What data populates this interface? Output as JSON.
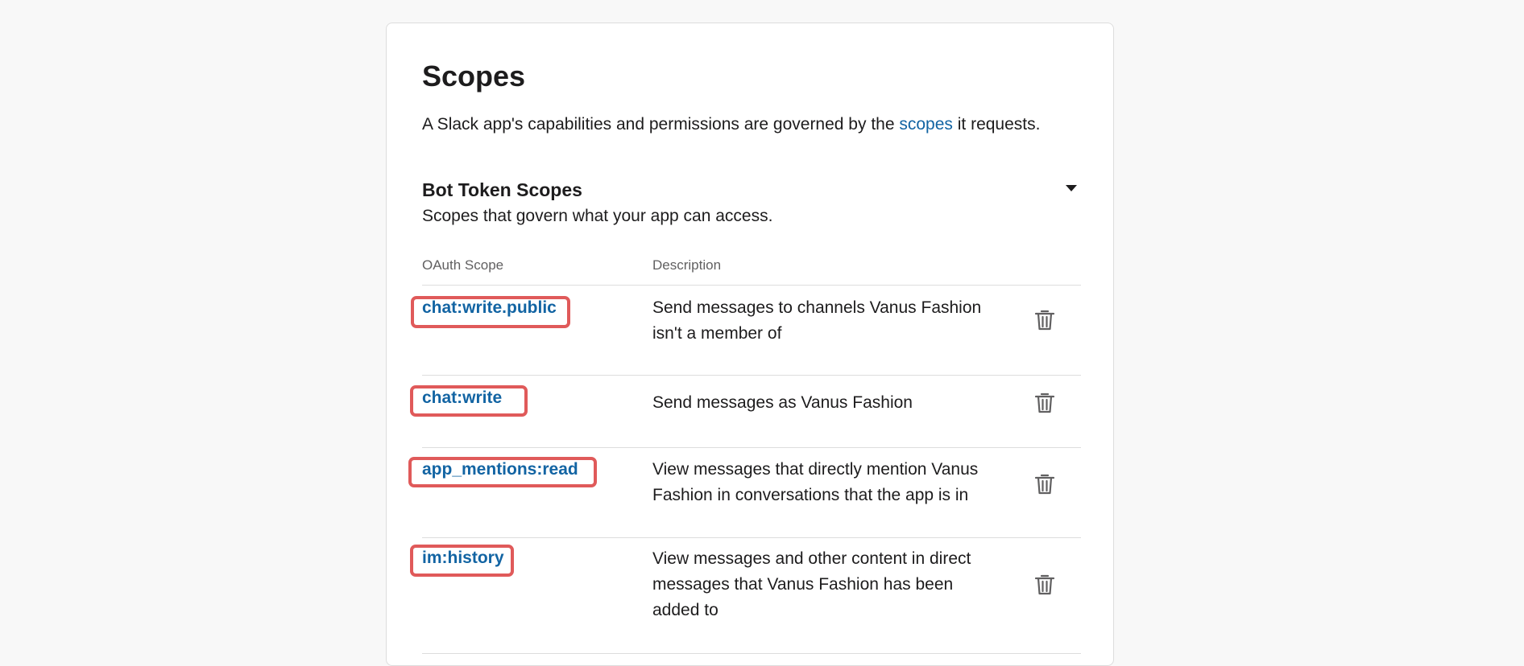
{
  "page": {
    "title": "Scopes",
    "intro_prefix": "A Slack app's capabilities and permissions are governed by the ",
    "intro_link": "scopes",
    "intro_suffix": " it requests."
  },
  "section": {
    "title": "Bot Token Scopes",
    "subtitle": "Scopes that govern what your app can access.",
    "toggle_icon": "caret-down-icon"
  },
  "table": {
    "headers": [
      "OAuth Scope",
      "Description"
    ],
    "rows": [
      {
        "scope": "chat:write.public",
        "description": "Send messages to channels Vanus Fashion isn't a member of",
        "action_icon": "trash-icon"
      },
      {
        "scope": "chat:write",
        "description": "Send messages as Vanus Fashion",
        "action_icon": "trash-icon"
      },
      {
        "scope": "app_mentions:read",
        "description": "View messages that directly mention Vanus Fashion in conversations that the app is in",
        "action_icon": "trash-icon"
      },
      {
        "scope": "im:history",
        "description": "View messages and other content in direct messages that Vanus Fashion has been added to",
        "action_icon": "trash-icon"
      }
    ]
  },
  "colors": {
    "link": "#1264a3",
    "highlight": "#e05a5a",
    "divider": "#dddddd",
    "text": "#1d1c1d",
    "muted": "#616061",
    "background": "#f8f8f8"
  }
}
